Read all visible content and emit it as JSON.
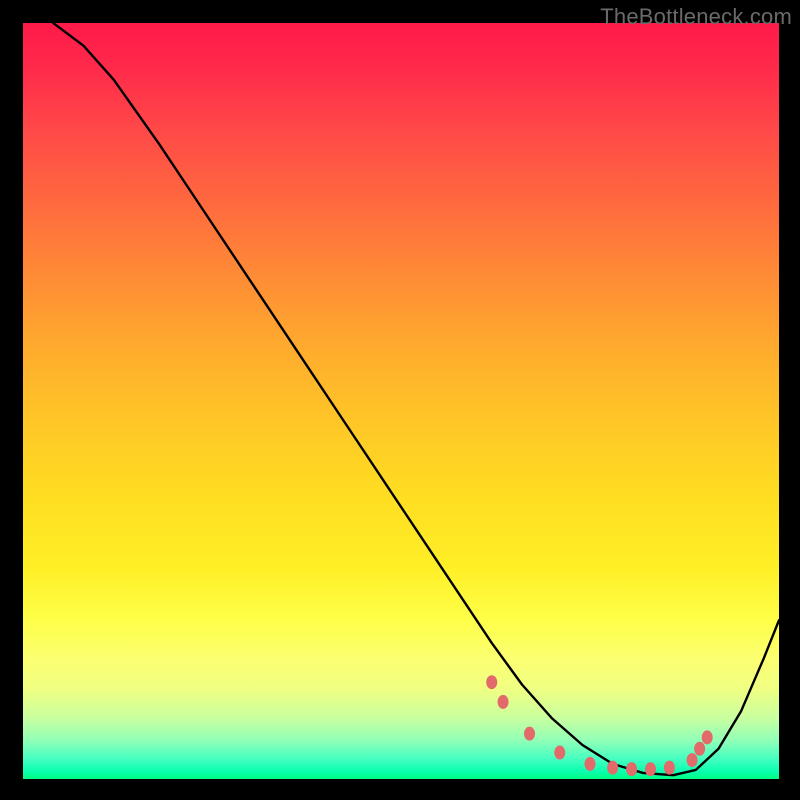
{
  "watermark": "TheBottleneck.com",
  "chart_data": {
    "type": "line",
    "title": "",
    "xlabel": "",
    "ylabel": "",
    "xlim": [
      0,
      100
    ],
    "ylim": [
      0,
      100
    ],
    "grid": false,
    "series": [
      {
        "name": "curve",
        "color": "#000000",
        "x": [
          4,
          8,
          12,
          18,
          24,
          30,
          36,
          42,
          48,
          54,
          58,
          62,
          66,
          70,
          74,
          78,
          82,
          86,
          89,
          92,
          95,
          98,
          100
        ],
        "y": [
          100,
          97,
          92.5,
          84,
          75,
          66,
          57,
          48,
          39,
          30,
          24,
          18,
          12.5,
          8,
          4.5,
          2,
          0.8,
          0.5,
          1.2,
          4,
          9,
          16,
          21
        ]
      }
    ],
    "markers": {
      "name": "dots",
      "color": "#e26a6a",
      "points": [
        [
          62,
          12.8
        ],
        [
          63.5,
          10.2
        ],
        [
          67,
          6
        ],
        [
          71,
          3.5
        ],
        [
          75,
          2
        ],
        [
          78,
          1.5
        ],
        [
          80.5,
          1.3
        ],
        [
          83,
          1.3
        ],
        [
          85.5,
          1.5
        ],
        [
          88.5,
          2.5
        ],
        [
          89.5,
          4
        ],
        [
          90.5,
          5.5
        ]
      ]
    }
  }
}
